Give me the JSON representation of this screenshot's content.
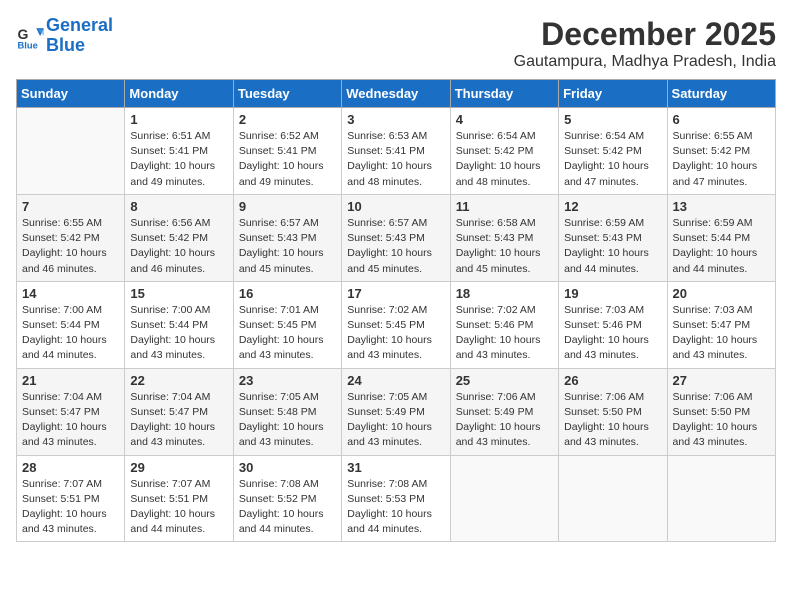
{
  "logo": {
    "line1": "General",
    "line2": "Blue"
  },
  "title": "December 2025",
  "subtitle": "Gautampura, Madhya Pradesh, India",
  "days_of_week": [
    "Sunday",
    "Monday",
    "Tuesday",
    "Wednesday",
    "Thursday",
    "Friday",
    "Saturday"
  ],
  "weeks": [
    [
      {
        "day": "",
        "info": ""
      },
      {
        "day": "1",
        "info": "Sunrise: 6:51 AM\nSunset: 5:41 PM\nDaylight: 10 hours\nand 49 minutes."
      },
      {
        "day": "2",
        "info": "Sunrise: 6:52 AM\nSunset: 5:41 PM\nDaylight: 10 hours\nand 49 minutes."
      },
      {
        "day": "3",
        "info": "Sunrise: 6:53 AM\nSunset: 5:41 PM\nDaylight: 10 hours\nand 48 minutes."
      },
      {
        "day": "4",
        "info": "Sunrise: 6:54 AM\nSunset: 5:42 PM\nDaylight: 10 hours\nand 48 minutes."
      },
      {
        "day": "5",
        "info": "Sunrise: 6:54 AM\nSunset: 5:42 PM\nDaylight: 10 hours\nand 47 minutes."
      },
      {
        "day": "6",
        "info": "Sunrise: 6:55 AM\nSunset: 5:42 PM\nDaylight: 10 hours\nand 47 minutes."
      }
    ],
    [
      {
        "day": "7",
        "info": "Sunrise: 6:55 AM\nSunset: 5:42 PM\nDaylight: 10 hours\nand 46 minutes."
      },
      {
        "day": "8",
        "info": "Sunrise: 6:56 AM\nSunset: 5:42 PM\nDaylight: 10 hours\nand 46 minutes."
      },
      {
        "day": "9",
        "info": "Sunrise: 6:57 AM\nSunset: 5:43 PM\nDaylight: 10 hours\nand 45 minutes."
      },
      {
        "day": "10",
        "info": "Sunrise: 6:57 AM\nSunset: 5:43 PM\nDaylight: 10 hours\nand 45 minutes."
      },
      {
        "day": "11",
        "info": "Sunrise: 6:58 AM\nSunset: 5:43 PM\nDaylight: 10 hours\nand 45 minutes."
      },
      {
        "day": "12",
        "info": "Sunrise: 6:59 AM\nSunset: 5:43 PM\nDaylight: 10 hours\nand 44 minutes."
      },
      {
        "day": "13",
        "info": "Sunrise: 6:59 AM\nSunset: 5:44 PM\nDaylight: 10 hours\nand 44 minutes."
      }
    ],
    [
      {
        "day": "14",
        "info": "Sunrise: 7:00 AM\nSunset: 5:44 PM\nDaylight: 10 hours\nand 44 minutes."
      },
      {
        "day": "15",
        "info": "Sunrise: 7:00 AM\nSunset: 5:44 PM\nDaylight: 10 hours\nand 43 minutes."
      },
      {
        "day": "16",
        "info": "Sunrise: 7:01 AM\nSunset: 5:45 PM\nDaylight: 10 hours\nand 43 minutes."
      },
      {
        "day": "17",
        "info": "Sunrise: 7:02 AM\nSunset: 5:45 PM\nDaylight: 10 hours\nand 43 minutes."
      },
      {
        "day": "18",
        "info": "Sunrise: 7:02 AM\nSunset: 5:46 PM\nDaylight: 10 hours\nand 43 minutes."
      },
      {
        "day": "19",
        "info": "Sunrise: 7:03 AM\nSunset: 5:46 PM\nDaylight: 10 hours\nand 43 minutes."
      },
      {
        "day": "20",
        "info": "Sunrise: 7:03 AM\nSunset: 5:47 PM\nDaylight: 10 hours\nand 43 minutes."
      }
    ],
    [
      {
        "day": "21",
        "info": "Sunrise: 7:04 AM\nSunset: 5:47 PM\nDaylight: 10 hours\nand 43 minutes."
      },
      {
        "day": "22",
        "info": "Sunrise: 7:04 AM\nSunset: 5:47 PM\nDaylight: 10 hours\nand 43 minutes."
      },
      {
        "day": "23",
        "info": "Sunrise: 7:05 AM\nSunset: 5:48 PM\nDaylight: 10 hours\nand 43 minutes."
      },
      {
        "day": "24",
        "info": "Sunrise: 7:05 AM\nSunset: 5:49 PM\nDaylight: 10 hours\nand 43 minutes."
      },
      {
        "day": "25",
        "info": "Sunrise: 7:06 AM\nSunset: 5:49 PM\nDaylight: 10 hours\nand 43 minutes."
      },
      {
        "day": "26",
        "info": "Sunrise: 7:06 AM\nSunset: 5:50 PM\nDaylight: 10 hours\nand 43 minutes."
      },
      {
        "day": "27",
        "info": "Sunrise: 7:06 AM\nSunset: 5:50 PM\nDaylight: 10 hours\nand 43 minutes."
      }
    ],
    [
      {
        "day": "28",
        "info": "Sunrise: 7:07 AM\nSunset: 5:51 PM\nDaylight: 10 hours\nand 43 minutes."
      },
      {
        "day": "29",
        "info": "Sunrise: 7:07 AM\nSunset: 5:51 PM\nDaylight: 10 hours\nand 44 minutes."
      },
      {
        "day": "30",
        "info": "Sunrise: 7:08 AM\nSunset: 5:52 PM\nDaylight: 10 hours\nand 44 minutes."
      },
      {
        "day": "31",
        "info": "Sunrise: 7:08 AM\nSunset: 5:53 PM\nDaylight: 10 hours\nand 44 minutes."
      },
      {
        "day": "",
        "info": ""
      },
      {
        "day": "",
        "info": ""
      },
      {
        "day": "",
        "info": ""
      }
    ]
  ]
}
